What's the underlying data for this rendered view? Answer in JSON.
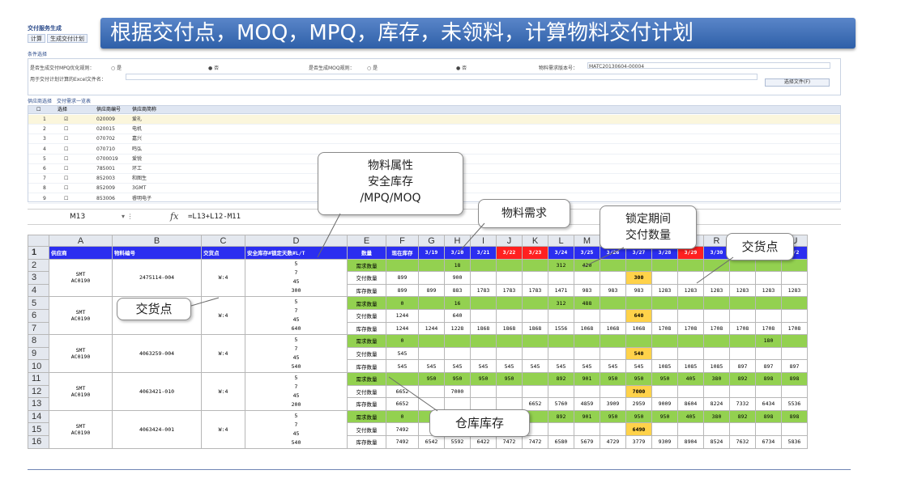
{
  "app": {
    "title": "交付服务生成",
    "toolbar": [
      "计算",
      "生成交付计划"
    ],
    "banner": "根据交付点，MOQ，MPQ，库存，未领料，计算物料交付计划"
  },
  "conditions": {
    "tab": "条件选择",
    "row1": [
      "是否生成交付MPQ优化规则：",
      "○ 是",
      "● 否",
      "是否生成MOQ规则：",
      "○ 是",
      "● 否",
      "物料需求版本号：",
      "MATC20130604-00004"
    ],
    "row2": "用于交付计划计算的Excel文件名：",
    "select_button": "选择文件(F)"
  },
  "supplier_list": {
    "tabs": [
      "供应商选择",
      "交付需求一览表"
    ],
    "headers": [
      "",
      "选择",
      "供应商编号",
      "供应商简称"
    ],
    "rows": [
      {
        "no": "1",
        "checked": true,
        "code": "020009",
        "name": "爱礼"
      },
      {
        "no": "2",
        "checked": false,
        "code": "020015",
        "name": "电机"
      },
      {
        "no": "3",
        "checked": false,
        "code": "070702",
        "name": "嘉兴"
      },
      {
        "no": "4",
        "checked": false,
        "code": "070710",
        "name": "鸣弘"
      },
      {
        "no": "5",
        "checked": false,
        "code": "0700019",
        "name": "爱锐"
      },
      {
        "no": "6",
        "checked": false,
        "code": "785001",
        "name": "环工"
      },
      {
        "no": "7",
        "checked": false,
        "code": "852003",
        "name": "和图生"
      },
      {
        "no": "8",
        "checked": false,
        "code": "852009",
        "name": "3GMT"
      },
      {
        "no": "9",
        "checked": false,
        "code": "853006",
        "name": "睿明电子"
      }
    ]
  },
  "callouts": {
    "material_attr": [
      "物料属性",
      "安全库存",
      "/MPQ/MOQ"
    ],
    "material_demand": "物料需求",
    "lock_period": [
      "锁定期间",
      "交付数量"
    ],
    "delivery_point_top": "交货点",
    "delivery_point_left": "交货点",
    "warehouse_stock": "仓库库存"
  },
  "formula_bar": {
    "name_box": "M13",
    "fx": "fx",
    "formula": "=L13+L12-M11"
  },
  "sheet": {
    "columns": [
      "A",
      "B",
      "C",
      "D",
      "E",
      "F",
      "G",
      "H",
      "I",
      "J",
      "K",
      "L",
      "M",
      "N",
      "O",
      "P",
      "Q",
      "R",
      "S",
      "T",
      "U"
    ],
    "header_row": [
      "供应商",
      "物料编号",
      "交货点",
      "安全库存#锁定天数#L/T",
      "数量",
      "现在库存",
      "3/19",
      "3/20",
      "3/21",
      "3/22",
      "3/23",
      "3/24",
      "3/25",
      "3/26",
      "3/27",
      "3/28",
      "3/29",
      "3/30",
      "3/31",
      "4/1",
      "4/2"
    ],
    "red_dates": [
      9,
      10,
      16
    ],
    "groups": [
      {
        "supplier": [
          "SMT",
          "AC0190"
        ],
        "part": "2475114-004",
        "point": "W:4",
        "attrs": [
          "5",
          "7",
          "45",
          "300"
        ],
        "demand": [
          "",
          "",
          "18",
          "",
          "",
          "",
          "312",
          "420",
          "",
          "",
          "",
          "",
          "",
          "",
          "",
          "",
          ""
        ],
        "delivery": [
          "899",
          "",
          "900",
          "",
          "",
          "",
          "",
          "",
          "",
          "300",
          "",
          "",
          "",
          "",
          "",
          "",
          ""
        ],
        "stock": [
          "899",
          "899",
          "883",
          "1783",
          "1783",
          "1783",
          "1471",
          "983",
          "983",
          "983",
          "1283",
          "1283",
          "1283",
          "1283",
          "1283",
          "1283",
          "1283"
        ]
      },
      {
        "supplier": [
          "SMT",
          "AC0190"
        ],
        "part": "2475121-003",
        "point": "W:4",
        "attrs": [
          "5",
          "7",
          "45",
          "640"
        ],
        "demand": [
          "0",
          "",
          "16",
          "",
          "",
          "",
          "312",
          "488",
          "",
          "",
          "",
          "",
          "",
          "",
          "",
          "",
          ""
        ],
        "delivery": [
          "1244",
          "",
          "640",
          "",
          "",
          "",
          "",
          "",
          "",
          "640",
          "",
          "",
          "",
          "",
          "",
          "",
          ""
        ],
        "stock": [
          "1244",
          "1244",
          "1228",
          "1868",
          "1868",
          "1868",
          "1556",
          "1068",
          "1068",
          "1068",
          "1708",
          "1708",
          "1708",
          "1708",
          "1708",
          "1708",
          "1708"
        ]
      },
      {
        "supplier": [
          "SMT",
          "AC0190"
        ],
        "part": "4063259-004",
        "point": "W:4",
        "attrs": [
          "5",
          "7",
          "45",
          "540"
        ],
        "demand": [
          "0",
          "",
          "",
          "",
          "",
          "",
          "",
          "",
          "",
          "",
          "",
          "",
          "",
          "",
          "180",
          "",
          ""
        ],
        "delivery": [
          "545",
          "",
          "",
          "",
          "",
          "",
          "",
          "",
          "",
          "540",
          "",
          "",
          "",
          "",
          "",
          "",
          ""
        ],
        "stock": [
          "545",
          "545",
          "545",
          "545",
          "545",
          "545",
          "545",
          "545",
          "545",
          "545",
          "1085",
          "1085",
          "1085",
          "897",
          "897",
          "897",
          "897"
        ]
      },
      {
        "supplier": [
          "SMT",
          "AC0190"
        ],
        "part": "4063421-010",
        "point": "W:4",
        "attrs": [
          "5",
          "7",
          "45",
          "200"
        ],
        "demand": [
          "",
          "950",
          "950",
          "950",
          "950",
          "",
          "892",
          "901",
          "950",
          "950",
          "950",
          "405",
          "380",
          "892",
          "898",
          "898",
          "898"
        ],
        "delivery": [
          "6652",
          "",
          "7000",
          "",
          "",
          "",
          "",
          "",
          "",
          "7000",
          "",
          "",
          "",
          "",
          "",
          "",
          ""
        ],
        "stock": [
          "6652",
          "",
          "",
          "",
          "",
          "6652",
          "5760",
          "4859",
          "3909",
          "2959",
          "9009",
          "8604",
          "8224",
          "7332",
          "6434",
          "5536",
          "5536"
        ]
      },
      {
        "supplier": [
          "SMT",
          "AC0190"
        ],
        "part": "4063424-001",
        "point": "W:4",
        "attrs": [
          "5",
          "7",
          "45",
          "540"
        ],
        "demand": [
          "0",
          "",
          "",
          "",
          "",
          "",
          "892",
          "901",
          "950",
          "950",
          "950",
          "405",
          "380",
          "892",
          "898",
          "898",
          "898"
        ],
        "delivery": [
          "7492",
          "",
          "",
          "",
          "",
          "",
          "",
          "",
          "",
          "6490",
          "",
          "",
          "",
          "",
          "",
          "",
          ""
        ],
        "stock": [
          "7492",
          "6542",
          "5592",
          "6422",
          "7472",
          "7472",
          "6580",
          "5679",
          "4729",
          "3779",
          "9309",
          "8904",
          "8524",
          "7632",
          "6734",
          "5836",
          "5836"
        ]
      }
    ],
    "qty_labels": [
      "需求数量",
      "交付数量",
      "库存数量"
    ]
  }
}
